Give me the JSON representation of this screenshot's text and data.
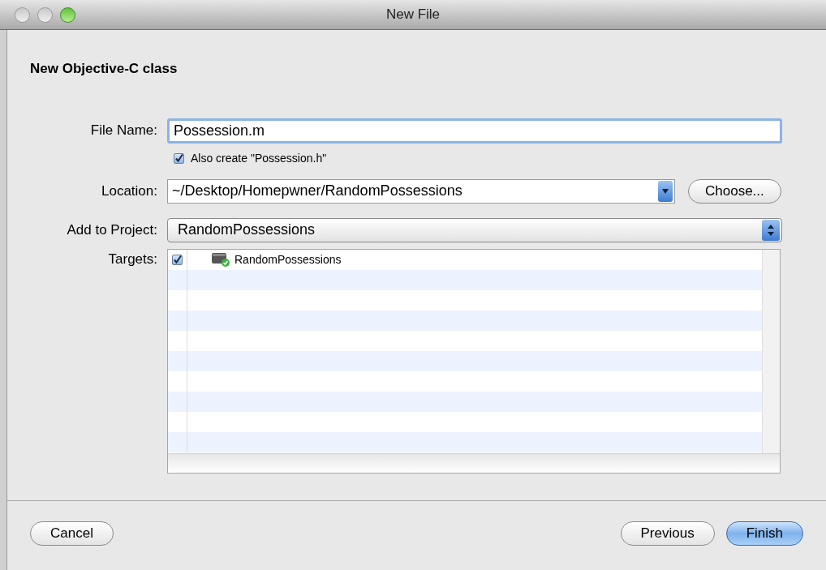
{
  "window": {
    "title": "New File"
  },
  "heading": "New Objective-C class",
  "file_name": {
    "label": "File Name:",
    "value": "Possession.m"
  },
  "also_create": {
    "label": "Also create \"Possession.h\"",
    "checked": true
  },
  "location": {
    "label": "Location:",
    "value": "~/Desktop/Homepwner/RandomPossessions",
    "button": "Choose..."
  },
  "project": {
    "label": "Add to Project:",
    "value": "RandomPossessions"
  },
  "targets": {
    "label": "Targets:",
    "rows": [
      {
        "name": "RandomPossessions",
        "checked": true
      }
    ]
  },
  "buttons": [
    {
      "label": "Cancel",
      "default": false
    },
    {
      "label": "Previous",
      "default": false
    },
    {
      "label": "Finish",
      "default": true
    }
  ]
}
